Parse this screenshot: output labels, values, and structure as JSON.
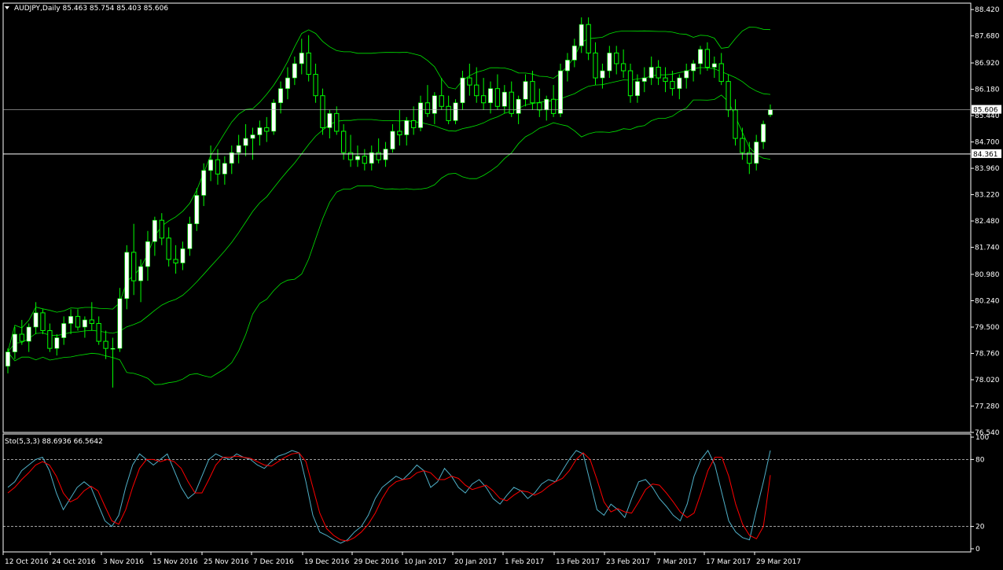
{
  "header": {
    "symbol_line": "AUDJPY,Daily  85.463 85.754 85.403 85.606",
    "indicator_line": "Sto(5,3,3) 88.6936 66.5642"
  },
  "colors": {
    "background": "#000000",
    "frame": "#ffffff",
    "candle_bull": "#ffffff",
    "candle_wick": "#00ff00",
    "bands": "#00e600",
    "stoch_main": "#4fb0c8",
    "stoch_signal": "#ff0000"
  },
  "chart_data": [
    {
      "type": "candlestick",
      "title": "AUDJPY,Daily",
      "ylim": [
        76.54,
        88.6
      ],
      "price_ticks": [
        "88.420",
        "87.680",
        "86.920",
        "86.180",
        "85.440",
        "84.700",
        "83.960",
        "83.220",
        "82.480",
        "81.740",
        "80.980",
        "80.240",
        "79.500",
        "78.760",
        "78.020",
        "77.280",
        "76.540"
      ],
      "current_price_label": "85.606",
      "level_label": "84.361",
      "x_ticks": [
        "12 Oct 2016",
        "24 Oct 2016",
        "3 Nov 2016",
        "15 Nov 2016",
        "25 Nov 2016",
        "7 Dec 2016",
        "19 Dec 2016",
        "29 Dec 2016",
        "10 Jan 2017",
        "20 Jan 2017",
        "1 Feb 2017",
        "13 Feb 2017",
        "23 Feb 2017",
        "7 Mar 2017",
        "17 Mar 2017",
        "29 Mar 2017"
      ],
      "last_bar": {
        "open": 85.463,
        "high": 85.754,
        "low": 85.403,
        "close": 85.606
      },
      "ohlc": [
        [
          78.4,
          78.9,
          78.2,
          78.8
        ],
        [
          78.8,
          79.5,
          78.6,
          79.3
        ],
        [
          79.3,
          79.7,
          79.0,
          79.1
        ],
        [
          79.1,
          79.6,
          78.8,
          79.5
        ],
        [
          79.5,
          80.2,
          79.3,
          79.9
        ],
        [
          79.9,
          80.0,
          79.3,
          79.4
        ],
        [
          79.4,
          79.6,
          78.8,
          78.9
        ],
        [
          78.9,
          79.3,
          78.7,
          79.2
        ],
        [
          79.2,
          79.8,
          79.0,
          79.6
        ],
        [
          79.6,
          80.0,
          79.3,
          79.8
        ],
        [
          79.8,
          80.0,
          79.4,
          79.5
        ],
        [
          79.5,
          79.8,
          79.2,
          79.7
        ],
        [
          79.7,
          80.2,
          79.4,
          79.6
        ],
        [
          79.6,
          79.8,
          79.0,
          79.1
        ],
        [
          79.1,
          79.4,
          78.6,
          78.9
        ],
        [
          78.9,
          79.2,
          77.8,
          78.9
        ],
        [
          78.9,
          80.6,
          78.8,
          80.3
        ],
        [
          80.3,
          81.8,
          80.0,
          81.6
        ],
        [
          81.6,
          82.4,
          80.4,
          80.8
        ],
        [
          80.8,
          81.4,
          80.2,
          81.2
        ],
        [
          81.2,
          82.2,
          80.8,
          81.9
        ],
        [
          81.9,
          82.6,
          81.5,
          82.5
        ],
        [
          82.5,
          82.7,
          81.8,
          82.0
        ],
        [
          82.0,
          82.3,
          81.2,
          81.4
        ],
        [
          81.4,
          81.8,
          81.0,
          81.3
        ],
        [
          81.3,
          81.9,
          81.1,
          81.7
        ],
        [
          81.7,
          82.6,
          81.5,
          82.4
        ],
        [
          82.4,
          83.4,
          82.2,
          83.2
        ],
        [
          83.2,
          84.1,
          82.9,
          83.9
        ],
        [
          83.9,
          84.6,
          83.6,
          84.2
        ],
        [
          84.2,
          84.5,
          83.5,
          83.8
        ],
        [
          83.8,
          84.3,
          83.5,
          84.1
        ],
        [
          84.1,
          84.6,
          83.8,
          84.4
        ],
        [
          84.4,
          84.9,
          84.1,
          84.6
        ],
        [
          84.6,
          85.2,
          84.3,
          84.8
        ],
        [
          84.8,
          85.1,
          84.2,
          84.9
        ],
        [
          84.9,
          85.3,
          84.6,
          85.1
        ],
        [
          85.1,
          85.4,
          84.7,
          85.0
        ],
        [
          85.0,
          85.9,
          84.9,
          85.8
        ],
        [
          85.8,
          86.4,
          85.5,
          86.2
        ],
        [
          86.2,
          86.8,
          85.9,
          86.5
        ],
        [
          86.5,
          87.1,
          86.3,
          86.9
        ],
        [
          86.9,
          87.6,
          86.6,
          87.2
        ],
        [
          87.2,
          87.7,
          86.4,
          86.6
        ],
        [
          86.6,
          86.9,
          85.8,
          86.0
        ],
        [
          86.0,
          86.2,
          84.9,
          85.1
        ],
        [
          85.1,
          85.6,
          84.8,
          85.5
        ],
        [
          85.5,
          85.7,
          84.9,
          85.0
        ],
        [
          85.0,
          85.2,
          84.2,
          84.4
        ],
        [
          84.4,
          84.9,
          84.0,
          84.2
        ],
        [
          84.2,
          84.6,
          84.0,
          84.3
        ],
        [
          84.3,
          84.5,
          83.9,
          84.1
        ],
        [
          84.1,
          84.6,
          83.9,
          84.4
        ],
        [
          84.4,
          84.8,
          84.1,
          84.2
        ],
        [
          84.2,
          84.7,
          84.0,
          84.5
        ],
        [
          84.5,
          85.2,
          84.4,
          85.0
        ],
        [
          85.0,
          85.6,
          84.6,
          84.9
        ],
        [
          84.9,
          85.4,
          84.6,
          85.3
        ],
        [
          85.3,
          85.7,
          84.9,
          85.1
        ],
        [
          85.1,
          86.0,
          85.0,
          85.8
        ],
        [
          85.8,
          86.3,
          85.4,
          85.5
        ],
        [
          85.5,
          86.1,
          85.2,
          86.0
        ],
        [
          86.0,
          86.5,
          85.6,
          85.7
        ],
        [
          85.7,
          86.0,
          85.2,
          85.3
        ],
        [
          85.3,
          85.9,
          85.2,
          85.8
        ],
        [
          85.8,
          86.7,
          85.6,
          86.5
        ],
        [
          86.5,
          86.9,
          86.0,
          86.3
        ],
        [
          86.3,
          86.8,
          85.8,
          86.0
        ],
        [
          86.0,
          86.5,
          85.6,
          85.8
        ],
        [
          85.8,
          86.4,
          85.5,
          86.2
        ],
        [
          86.2,
          86.6,
          85.6,
          85.7
        ],
        [
          85.7,
          86.3,
          85.5,
          86.1
        ],
        [
          86.1,
          86.4,
          85.4,
          85.5
        ],
        [
          85.5,
          86.0,
          85.2,
          85.9
        ],
        [
          85.9,
          86.6,
          85.7,
          86.4
        ],
        [
          86.4,
          86.7,
          85.6,
          85.8
        ],
        [
          85.8,
          86.2,
          85.4,
          85.6
        ],
        [
          85.6,
          86.0,
          85.3,
          85.9
        ],
        [
          85.9,
          86.3,
          85.4,
          85.5
        ],
        [
          85.5,
          86.9,
          85.4,
          86.7
        ],
        [
          86.7,
          87.2,
          86.4,
          87.0
        ],
        [
          87.0,
          87.6,
          86.8,
          87.4
        ],
        [
          87.4,
          88.2,
          87.2,
          88.0
        ],
        [
          88.0,
          88.2,
          87.0,
          87.2
        ],
        [
          87.2,
          87.5,
          86.3,
          86.5
        ],
        [
          86.5,
          86.9,
          86.2,
          86.7
        ],
        [
          86.7,
          87.4,
          86.5,
          87.2
        ],
        [
          87.2,
          87.4,
          86.6,
          86.9
        ],
        [
          86.9,
          87.3,
          86.5,
          86.7
        ],
        [
          86.7,
          86.9,
          85.8,
          86.0
        ],
        [
          86.0,
          86.6,
          85.8,
          86.4
        ],
        [
          86.4,
          86.8,
          86.1,
          86.5
        ],
        [
          86.5,
          87.1,
          86.3,
          86.8
        ],
        [
          86.8,
          87.0,
          86.3,
          86.5
        ],
        [
          86.5,
          86.8,
          86.1,
          86.4
        ],
        [
          86.4,
          86.7,
          86.0,
          86.2
        ],
        [
          86.2,
          86.6,
          85.9,
          86.5
        ],
        [
          86.5,
          86.9,
          86.2,
          86.7
        ],
        [
          86.7,
          87.0,
          86.4,
          86.9
        ],
        [
          86.9,
          87.4,
          86.6,
          87.3
        ],
        [
          87.3,
          87.5,
          86.7,
          86.8
        ],
        [
          86.8,
          87.1,
          86.5,
          86.9
        ],
        [
          86.9,
          87.2,
          86.3,
          86.4
        ],
        [
          86.4,
          86.6,
          85.4,
          85.6
        ],
        [
          85.6,
          85.9,
          84.6,
          84.8
        ],
        [
          84.8,
          85.1,
          84.2,
          84.4
        ],
        [
          84.4,
          84.7,
          83.8,
          84.1
        ],
        [
          84.1,
          84.9,
          83.9,
          84.7
        ],
        [
          84.7,
          85.3,
          84.5,
          85.2
        ],
        [
          85.463,
          85.754,
          85.403,
          85.606
        ]
      ]
    },
    {
      "type": "line",
      "title": "Sto(5,3,3)",
      "ylim": [
        0,
        100
      ],
      "y_ticks": [
        "100",
        "80",
        "20",
        "0"
      ],
      "levels": [
        80,
        20
      ],
      "main": [
        55,
        60,
        70,
        75,
        80,
        82,
        70,
        50,
        35,
        45,
        55,
        60,
        55,
        40,
        25,
        20,
        30,
        55,
        75,
        85,
        80,
        75,
        80,
        85,
        70,
        55,
        45,
        50,
        65,
        80,
        85,
        82,
        80,
        85,
        82,
        80,
        75,
        72,
        78,
        83,
        85,
        88,
        86,
        60,
        30,
        15,
        12,
        8,
        5,
        8,
        15,
        20,
        30,
        45,
        55,
        60,
        65,
        62,
        68,
        75,
        70,
        55,
        60,
        72,
        65,
        55,
        50,
        58,
        62,
        55,
        45,
        40,
        48,
        55,
        52,
        45,
        50,
        58,
        62,
        60,
        70,
        80,
        88,
        85,
        60,
        35,
        30,
        40,
        35,
        28,
        45,
        60,
        62,
        55,
        45,
        38,
        30,
        25,
        40,
        65,
        80,
        88,
        75,
        50,
        25,
        15,
        10,
        8,
        35,
        60,
        88
      ],
      "signal": [
        50,
        55,
        62,
        68,
        75,
        78,
        75,
        65,
        50,
        42,
        45,
        52,
        56,
        52,
        38,
        25,
        22,
        35,
        55,
        72,
        80,
        80,
        78,
        80,
        78,
        72,
        60,
        50,
        50,
        62,
        75,
        82,
        82,
        83,
        82,
        81,
        78,
        75,
        74,
        78,
        82,
        85,
        86,
        78,
        55,
        32,
        18,
        12,
        8,
        7,
        10,
        15,
        22,
        32,
        45,
        55,
        60,
        62,
        63,
        68,
        70,
        68,
        62,
        62,
        65,
        63,
        57,
        53,
        55,
        57,
        52,
        45,
        43,
        48,
        52,
        51,
        48,
        51,
        56,
        60,
        63,
        70,
        80,
        86,
        80,
        62,
        42,
        33,
        36,
        33,
        32,
        42,
        53,
        58,
        57,
        50,
        42,
        33,
        28,
        32,
        50,
        70,
        82,
        82,
        65,
        40,
        22,
        12,
        9,
        20,
        66
      ]
    }
  ]
}
